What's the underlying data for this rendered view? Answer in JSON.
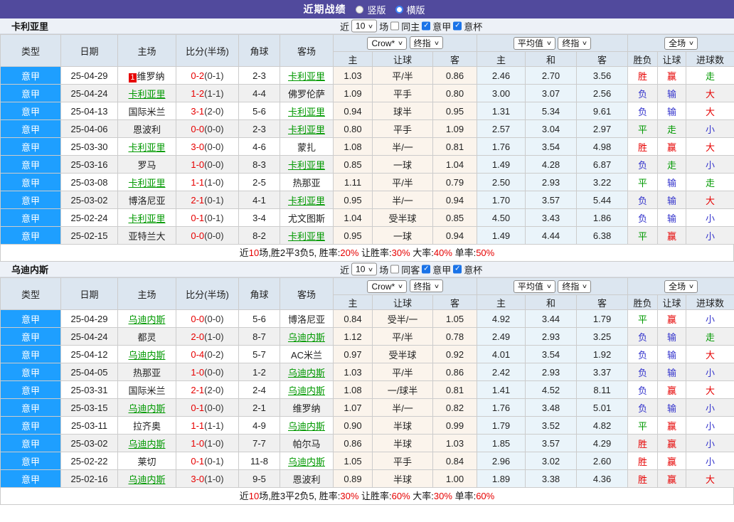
{
  "topbar": {
    "title": "近期战绩",
    "vertical_label": "竖版",
    "horizontal_label": "横版",
    "selected_mode": "横版"
  },
  "colors": {
    "accent_purple": "#514a9d",
    "type_blue": "#1e9fff",
    "win_red": "#e60000",
    "draw_green": "#009900",
    "lose_blue": "#3333cc",
    "featured_team_green": "#009900"
  },
  "shared": {
    "near_label": "近",
    "games_label": "场",
    "league_label": "意甲",
    "cup_label": "意杯",
    "h_type": "类型",
    "h_date": "日期",
    "h_home": "主场",
    "h_score": "比分(半场)",
    "h_corner": "角球",
    "h_away": "客场",
    "h_h": "主",
    "h_hcap": "让球",
    "h_a": "客",
    "h_avg_h": "主",
    "h_avg_d": "和",
    "h_avg_a": "客",
    "h_res": "胜负",
    "h_hres": "让球",
    "h_goals": "进球数",
    "sel_bookmaker": "Crow*",
    "sel_final": "终指",
    "sel_avg": "平均值",
    "sel_scope": "全场"
  },
  "sections": [
    {
      "team": "卡利亚里",
      "count": "10",
      "same_label": "同主",
      "rows": [
        {
          "league": "意甲",
          "date": "25-04-29",
          "home": "维罗纳",
          "home_rank": "1",
          "score": "0-2",
          "half": "(0-1)",
          "corner": "2-3",
          "away": "卡利亚里",
          "away_featured": true,
          "w": "1.03",
          "hcap": "平/半",
          "l": "0.86",
          "ah": "2.46",
          "ad": "2.70",
          "aa": "3.56",
          "res": "胜",
          "hres": "赢",
          "gres": "走"
        },
        {
          "league": "意甲",
          "date": "25-04-24",
          "home": "卡利亚里",
          "home_featured": true,
          "score": "1-2",
          "half": "(1-1)",
          "corner": "4-4",
          "away": "佛罗伦萨",
          "w": "1.09",
          "hcap": "平手",
          "l": "0.80",
          "ah": "3.00",
          "ad": "3.07",
          "aa": "2.56",
          "res": "负",
          "hres": "输",
          "gres": "大"
        },
        {
          "league": "意甲",
          "date": "25-04-13",
          "home": "国际米兰",
          "score": "3-1",
          "half": "(2-0)",
          "corner": "5-6",
          "away": "卡利亚里",
          "away_featured": true,
          "w": "0.94",
          "hcap": "球半",
          "l": "0.95",
          "ah": "1.31",
          "ad": "5.34",
          "aa": "9.61",
          "res": "负",
          "hres": "输",
          "gres": "大"
        },
        {
          "league": "意甲",
          "date": "25-04-06",
          "home": "恩波利",
          "score": "0-0",
          "half": "(0-0)",
          "corner": "2-3",
          "away": "卡利亚里",
          "away_featured": true,
          "w": "0.80",
          "hcap": "平手",
          "l": "1.09",
          "ah": "2.57",
          "ad": "3.04",
          "aa": "2.97",
          "res": "平",
          "hres": "走",
          "gres": "小"
        },
        {
          "league": "意甲",
          "date": "25-03-30",
          "home": "卡利亚里",
          "home_featured": true,
          "score": "3-0",
          "half": "(0-0)",
          "corner": "4-6",
          "away": "蒙扎",
          "w": "1.08",
          "hcap": "半/一",
          "l": "0.81",
          "ah": "1.76",
          "ad": "3.54",
          "aa": "4.98",
          "res": "胜",
          "hres": "赢",
          "gres": "大"
        },
        {
          "league": "意甲",
          "date": "25-03-16",
          "home": "罗马",
          "score": "1-0",
          "half": "(0-0)",
          "corner": "8-3",
          "away": "卡利亚里",
          "away_featured": true,
          "w": "0.85",
          "hcap": "一球",
          "l": "1.04",
          "ah": "1.49",
          "ad": "4.28",
          "aa": "6.87",
          "res": "负",
          "hres": "走",
          "gres": "小"
        },
        {
          "league": "意甲",
          "date": "25-03-08",
          "home": "卡利亚里",
          "home_featured": true,
          "score": "1-1",
          "half": "(1-0)",
          "corner": "2-5",
          "away": "热那亚",
          "w": "1.11",
          "hcap": "平/半",
          "l": "0.79",
          "ah": "2.50",
          "ad": "2.93",
          "aa": "3.22",
          "res": "平",
          "hres": "输",
          "gres": "走"
        },
        {
          "league": "意甲",
          "date": "25-03-02",
          "home": "博洛尼亚",
          "score": "2-1",
          "half": "(0-1)",
          "corner": "4-1",
          "away": "卡利亚里",
          "away_featured": true,
          "w": "0.95",
          "hcap": "半/一",
          "l": "0.94",
          "ah": "1.70",
          "ad": "3.57",
          "aa": "5.44",
          "res": "负",
          "hres": "输",
          "gres": "大"
        },
        {
          "league": "意甲",
          "date": "25-02-24",
          "home": "卡利亚里",
          "home_featured": true,
          "score": "0-1",
          "half": "(0-1)",
          "corner": "3-4",
          "away": "尤文图斯",
          "w": "1.04",
          "hcap": "受半球",
          "l": "0.85",
          "ah": "4.50",
          "ad": "3.43",
          "aa": "1.86",
          "res": "负",
          "hres": "输",
          "gres": "小"
        },
        {
          "league": "意甲",
          "date": "25-02-15",
          "home": "亚特兰大",
          "score": "0-0",
          "half": "(0-0)",
          "corner": "8-2",
          "away": "卡利亚里",
          "away_featured": true,
          "w": "0.95",
          "hcap": "一球",
          "l": "0.94",
          "ah": "1.49",
          "ad": "4.44",
          "aa": "6.38",
          "res": "平",
          "hres": "赢",
          "gres": "小"
        }
      ],
      "summary_parts": [
        "近",
        "10",
        "场,胜2平3负5, 胜率:",
        "20%",
        " 让胜率:",
        "30%",
        " 大率:",
        "40%",
        " 单率:",
        "50%"
      ]
    },
    {
      "team": "乌迪内斯",
      "count": "10",
      "same_label": "同客",
      "rows": [
        {
          "league": "意甲",
          "date": "25-04-29",
          "home": "乌迪内斯",
          "home_featured": true,
          "score": "0-0",
          "half": "(0-0)",
          "corner": "5-6",
          "away": "博洛尼亚",
          "w": "0.84",
          "hcap": "受半/一",
          "l": "1.05",
          "ah": "4.92",
          "ad": "3.44",
          "aa": "1.79",
          "res": "平",
          "hres": "赢",
          "gres": "小"
        },
        {
          "league": "意甲",
          "date": "25-04-24",
          "home": "都灵",
          "score": "2-0",
          "half": "(1-0)",
          "corner": "8-7",
          "away": "乌迪内斯",
          "away_featured": true,
          "w": "1.12",
          "hcap": "平/半",
          "l": "0.78",
          "ah": "2.49",
          "ad": "2.93",
          "aa": "3.25",
          "res": "负",
          "hres": "输",
          "gres": "走"
        },
        {
          "league": "意甲",
          "date": "25-04-12",
          "home": "乌迪内斯",
          "home_featured": true,
          "score": "0-4",
          "half": "(0-2)",
          "corner": "5-7",
          "away": "AC米兰",
          "w": "0.97",
          "hcap": "受半球",
          "l": "0.92",
          "ah": "4.01",
          "ad": "3.54",
          "aa": "1.92",
          "res": "负",
          "hres": "输",
          "gres": "大"
        },
        {
          "league": "意甲",
          "date": "25-04-05",
          "home": "热那亚",
          "score": "1-0",
          "half": "(0-0)",
          "corner": "1-2",
          "away": "乌迪内斯",
          "away_featured": true,
          "w": "1.03",
          "hcap": "平/半",
          "l": "0.86",
          "ah": "2.42",
          "ad": "2.93",
          "aa": "3.37",
          "res": "负",
          "hres": "输",
          "gres": "小"
        },
        {
          "league": "意甲",
          "date": "25-03-31",
          "home": "国际米兰",
          "score": "2-1",
          "half": "(2-0)",
          "corner": "2-4",
          "away": "乌迪内斯",
          "away_featured": true,
          "w": "1.08",
          "hcap": "一/球半",
          "l": "0.81",
          "ah": "1.41",
          "ad": "4.52",
          "aa": "8.11",
          "res": "负",
          "hres": "赢",
          "gres": "大"
        },
        {
          "league": "意甲",
          "date": "25-03-15",
          "home": "乌迪内斯",
          "home_featured": true,
          "score": "0-1",
          "half": "(0-0)",
          "corner": "2-1",
          "away": "维罗纳",
          "w": "1.07",
          "hcap": "半/一",
          "l": "0.82",
          "ah": "1.76",
          "ad": "3.48",
          "aa": "5.01",
          "res": "负",
          "hres": "输",
          "gres": "小"
        },
        {
          "league": "意甲",
          "date": "25-03-11",
          "home": "拉齐奥",
          "score": "1-1",
          "half": "(1-1)",
          "corner": "4-9",
          "away": "乌迪内斯",
          "away_featured": true,
          "w": "0.90",
          "hcap": "半球",
          "l": "0.99",
          "ah": "1.79",
          "ad": "3.52",
          "aa": "4.82",
          "res": "平",
          "hres": "赢",
          "gres": "小"
        },
        {
          "league": "意甲",
          "date": "25-03-02",
          "home": "乌迪内斯",
          "home_featured": true,
          "score": "1-0",
          "half": "(1-0)",
          "corner": "7-7",
          "away": "帕尔马",
          "w": "0.86",
          "hcap": "半球",
          "l": "1.03",
          "ah": "1.85",
          "ad": "3.57",
          "aa": "4.29",
          "res": "胜",
          "hres": "赢",
          "gres": "小"
        },
        {
          "league": "意甲",
          "date": "25-02-22",
          "home": "莱切",
          "score": "0-1",
          "half": "(0-1)",
          "corner": "11-8",
          "away": "乌迪内斯",
          "away_featured": true,
          "w": "1.05",
          "hcap": "平手",
          "l": "0.84",
          "ah": "2.96",
          "ad": "3.02",
          "aa": "2.60",
          "res": "胜",
          "hres": "赢",
          "gres": "小"
        },
        {
          "league": "意甲",
          "date": "25-02-16",
          "home": "乌迪内斯",
          "home_featured": true,
          "score": "3-0",
          "half": "(1-0)",
          "corner": "9-5",
          "away": "恩波利",
          "w": "0.89",
          "hcap": "半球",
          "l": "1.00",
          "ah": "1.89",
          "ad": "3.38",
          "aa": "4.36",
          "res": "胜",
          "hres": "赢",
          "gres": "大"
        }
      ],
      "summary_parts": [
        "近",
        "10",
        "场,胜3平2负5, 胜率:",
        "30%",
        " 让胜率:",
        "60%",
        " 大率:",
        "30%",
        " 单率:",
        "60%"
      ]
    }
  ]
}
